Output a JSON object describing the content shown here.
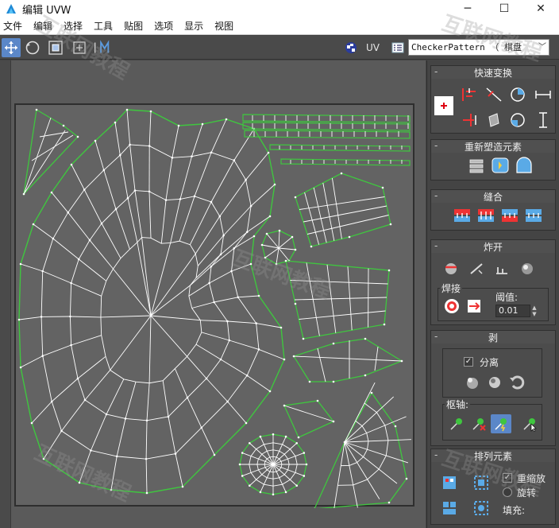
{
  "window": {
    "title": "编辑 UVW",
    "controls": [
      "minimize-icon",
      "maximize-icon",
      "close-icon"
    ]
  },
  "menu": {
    "items": [
      "文件",
      "编辑",
      "选择",
      "工具",
      "贴图",
      "选项",
      "显示",
      "视图"
    ]
  },
  "toolbar": {
    "uv_label": "UV",
    "texture_select": "CheckerPattern （ 棋盘",
    "active_tool": "move-icon",
    "tools": [
      "move-icon",
      "rotate-icon",
      "scale-icon",
      "freeform-icon",
      "mirror-icon",
      "checker-icon",
      "uv-options-icon",
      "list-icon"
    ]
  },
  "panel": {
    "quick_transform": {
      "title": "快速变换",
      "buttons": [
        "set-pivot-icon",
        "align-icon",
        "rotate-90-cw-icon",
        "space-horizontal-icon",
        "align-edges-icon",
        "straighten-icon",
        "rotate-90-ccw-icon",
        "space-vertical-icon"
      ]
    },
    "reshape": {
      "title": "重新塑造元素",
      "buttons": [
        "straighten-selection-icon",
        "relax-icon",
        "relax-options-icon"
      ]
    },
    "stitch": {
      "title": "缝合",
      "buttons": [
        "stitch-to-target-icon",
        "stitch-average-icon",
        "stitch-source-icon",
        "stitch-custom-icon"
      ]
    },
    "explode": {
      "title": "炸开",
      "buttons": [
        "break-icon",
        "detach-edge-icon",
        "flatten-icon",
        "explode-icon"
      ],
      "weld": {
        "label": "焊接",
        "buttons": [
          "target-weld-icon",
          "weld-selected-icon"
        ],
        "threshold_label": "阈值:",
        "threshold_value": "0.01"
      }
    },
    "peel": {
      "title": "剥",
      "detach_label": "分离",
      "detach_checked": true,
      "buttons": [
        "quick-peel-icon",
        "peel-mode-icon",
        "reset-peel-icon"
      ],
      "pivot": {
        "label": "枢轴:",
        "buttons": [
          "pin-icon",
          "unpin-icon",
          "auto-pin-icon",
          "pin-options-icon"
        ],
        "active": "auto-pin-icon"
      }
    },
    "arrange": {
      "title": "排列元素",
      "rescale_label": "重缩放",
      "rescale_checked": true,
      "rotate_label": "旋转",
      "rotate_checked": false,
      "padding_label": "填充:",
      "buttons": [
        "pack-normalize-icon",
        "pack-together-icon",
        "pack-custom-icon",
        "group-icon"
      ]
    }
  },
  "watermark_text": "互联网教程",
  "colors": {
    "accent": "#5b87c8",
    "uv_border": "#3fc63f",
    "uv_edge": "#ffffff",
    "viewport_bg": "#5a5a5a"
  }
}
